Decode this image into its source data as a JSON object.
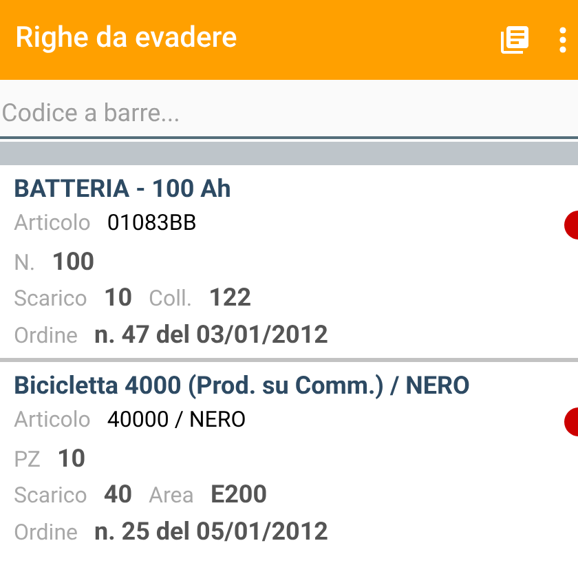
{
  "app_bar": {
    "title": "Righe da evadere"
  },
  "search": {
    "placeholder": "Codice a barre..."
  },
  "rows": [
    {
      "title": "BATTERIA - 100 Ah",
      "color": "#cc0000",
      "lines": [
        [
          {
            "label": "Articolo",
            "value": "01083BB",
            "bold": false
          }
        ],
        [
          {
            "label": "N.",
            "value": "100",
            "bold": true
          }
        ],
        [
          {
            "label": "Scarico",
            "value": "10",
            "bold": true
          },
          {
            "label": "Coll.",
            "value": "122",
            "bold": true
          }
        ],
        [
          {
            "label": "Ordine",
            "value": "n. 47 del 03/01/2012",
            "bold": true
          }
        ]
      ]
    },
    {
      "title": "Bicicletta 4000 (Prod. su Comm.) / NERO",
      "color": "#cc0000",
      "lines": [
        [
          {
            "label": "Articolo",
            "value": "40000 / NERO",
            "bold": false
          }
        ],
        [
          {
            "label": "PZ",
            "value": "10",
            "bold": true
          }
        ],
        [
          {
            "label": "Scarico",
            "value": "40",
            "bold": true
          },
          {
            "label": "Area",
            "value": "E200",
            "bold": true
          }
        ],
        [
          {
            "label": "Ordine",
            "value": "n. 25 del 05/01/2012",
            "bold": true
          }
        ]
      ]
    }
  ]
}
